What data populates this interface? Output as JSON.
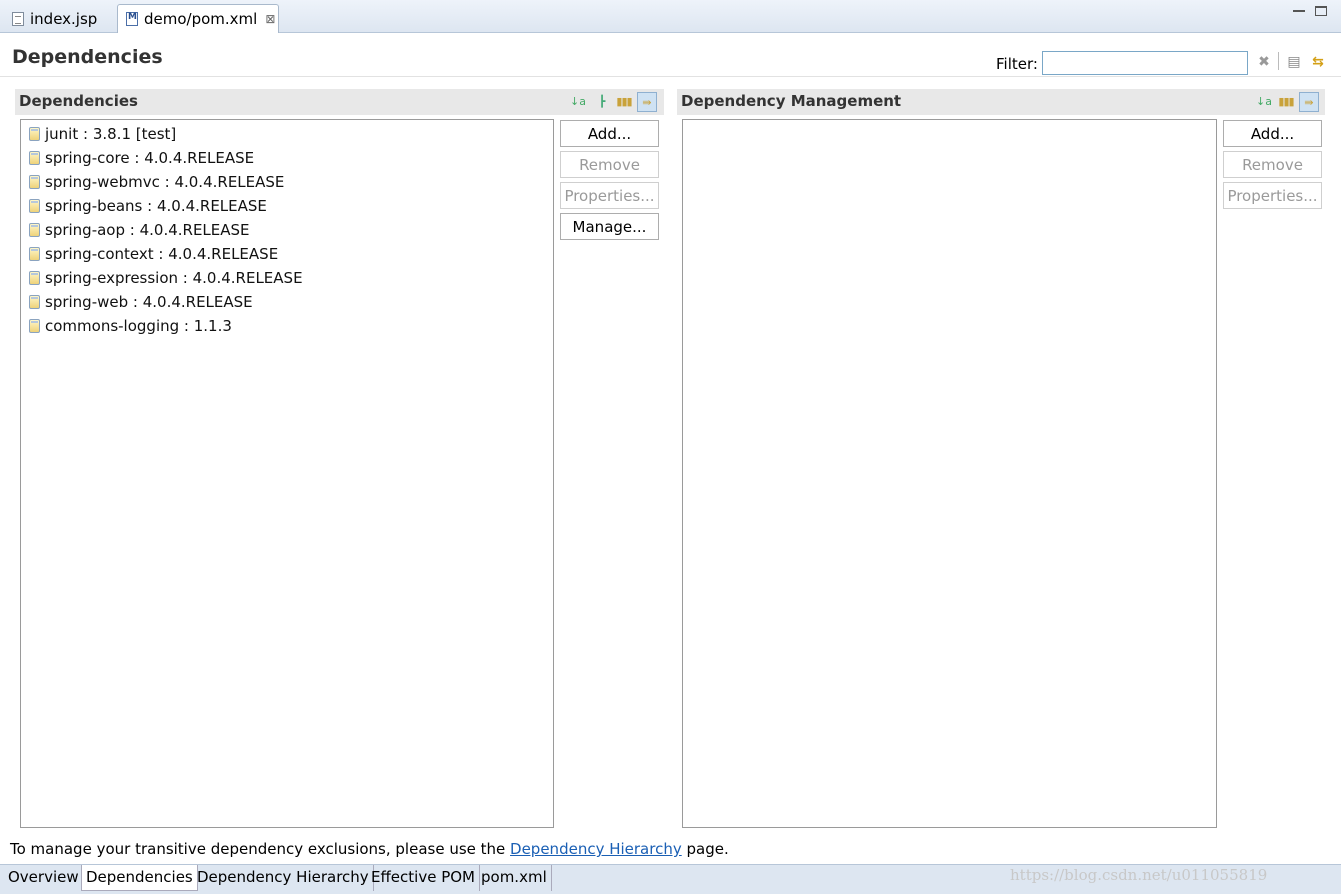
{
  "editor_tabs": [
    {
      "label": "index.jsp",
      "icon": "jsp-file-icon"
    },
    {
      "label": "demo/pom.xml",
      "icon": "maven-pom-icon",
      "close": "⊠"
    }
  ],
  "header": {
    "title": "Dependencies",
    "filter_label": "Filter:",
    "filter_value": ""
  },
  "dependencies": {
    "title": "Dependencies",
    "items": [
      "junit : 3.8.1 [test]",
      "spring-core : 4.0.4.RELEASE",
      "spring-webmvc : 4.0.4.RELEASE",
      "spring-beans : 4.0.4.RELEASE",
      "spring-aop : 4.0.4.RELEASE",
      "spring-context : 4.0.4.RELEASE",
      "spring-expression : 4.0.4.RELEASE",
      "spring-web : 4.0.4.RELEASE",
      "commons-logging : 1.1.3"
    ],
    "buttons": {
      "add": "Add...",
      "remove": "Remove",
      "properties": "Properties...",
      "manage": "Manage..."
    }
  },
  "dependency_management": {
    "title": "Dependency Management",
    "items": [],
    "buttons": {
      "add": "Add...",
      "remove": "Remove",
      "properties": "Properties..."
    }
  },
  "footer": {
    "note_before": "To manage your transitive dependency exclusions, please use the ",
    "link": "Dependency Hierarchy",
    "note_after": " page."
  },
  "page_tabs": [
    "Overview",
    "Dependencies",
    "Dependency Hierarchy",
    "Effective POM",
    "pom.xml"
  ],
  "active_page_tab": "Dependencies",
  "watermark": "https://blog.csdn.net/u011055819",
  "colors": {
    "link": "#1a5fb4",
    "tab_bar": "#dde6f1",
    "section_bar": "#e8e8e8"
  }
}
